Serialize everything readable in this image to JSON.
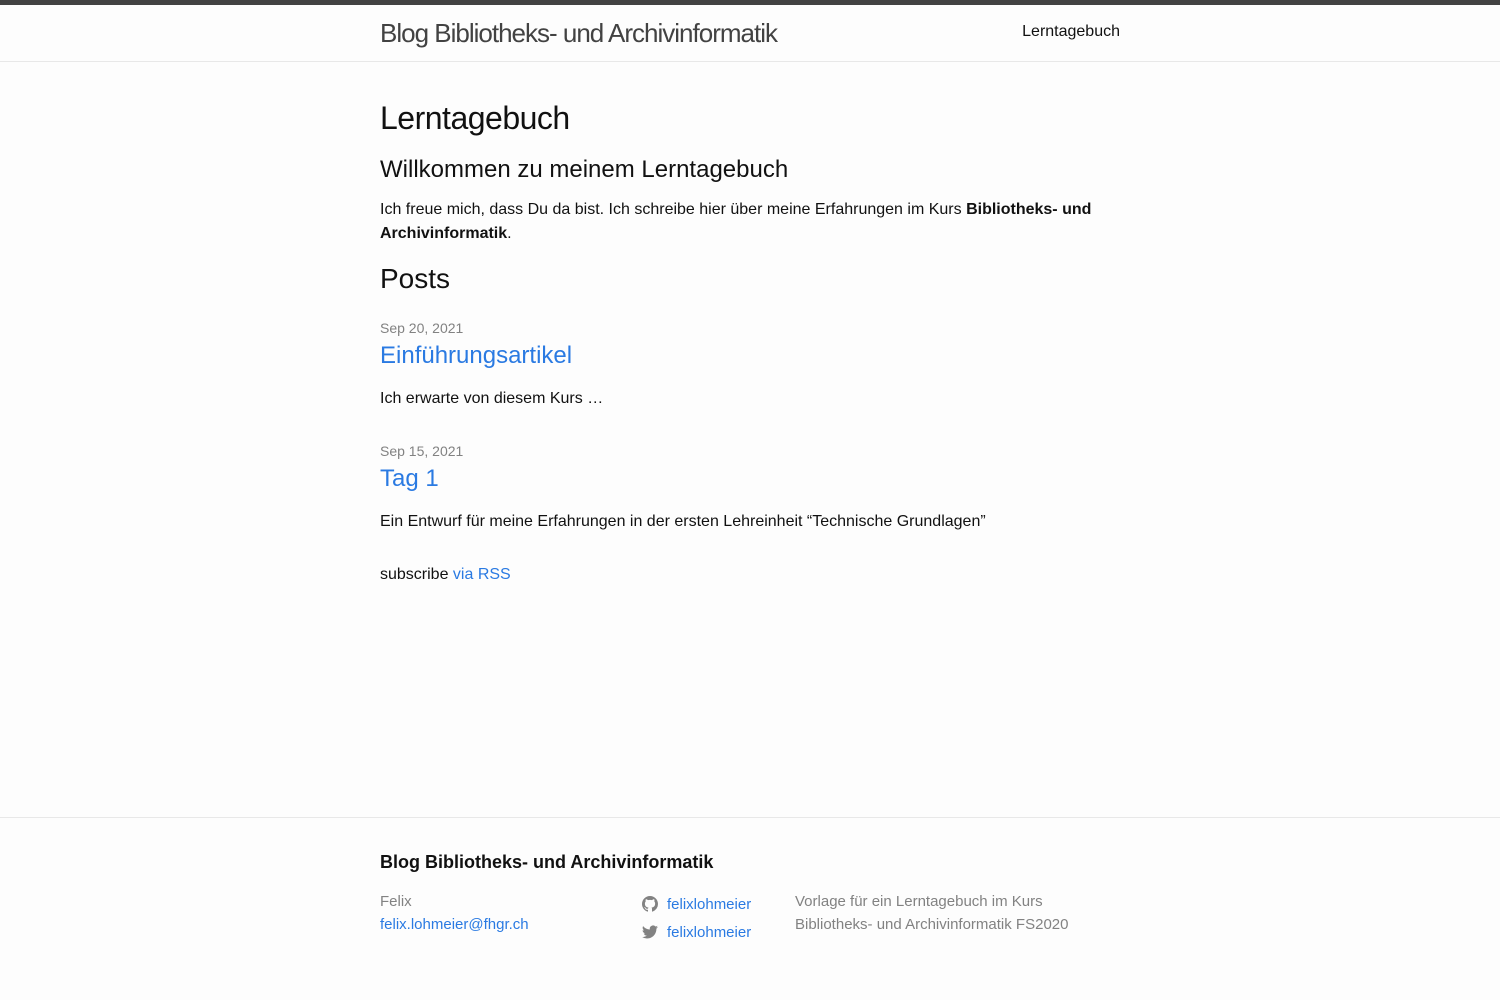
{
  "header": {
    "site_title": "Blog Bibliotheks- und Archivinformatik",
    "nav": [
      {
        "label": "Lerntagebuch"
      }
    ]
  },
  "main": {
    "page_heading": "Lerntagebuch",
    "welcome_heading": "Willkommen zu meinem Lerntagebuch",
    "intro_text": "Ich freue mich, dass Du da bist. Ich schreibe hier über meine Erfahrungen im Kurs ",
    "intro_bold": "Bibliotheks- und Archivinformatik",
    "intro_end": ".",
    "posts_heading": "Posts",
    "posts": [
      {
        "date": "Sep 20, 2021",
        "title": "Einführungsartikel",
        "excerpt": "Ich erwarte von diesem Kurs …"
      },
      {
        "date": "Sep 15, 2021",
        "title": "Tag 1",
        "excerpt": "Ein Entwurf für meine Erfahrungen in der ersten Lehreinheit “Technische Grundlagen”"
      }
    ],
    "rss_prefix": "subscribe ",
    "rss_link": "via RSS"
  },
  "footer": {
    "heading": "Blog Bibliotheks- und Archivinformatik",
    "author_name": "Felix",
    "author_email": "felix.lohmeier@fhgr.ch",
    "social": [
      {
        "icon": "github-icon",
        "username": "felixlohmeier"
      },
      {
        "icon": "twitter-icon",
        "username": "felixlohmeier"
      }
    ],
    "description": "Vorlage für ein Lerntagebuch im Kurs Bibliotheks- und Archivinformatik FS2020"
  },
  "colors": {
    "link": "#2a7ae2",
    "muted": "#828282",
    "header_border": "#424242",
    "background": "#fdfdfd"
  }
}
